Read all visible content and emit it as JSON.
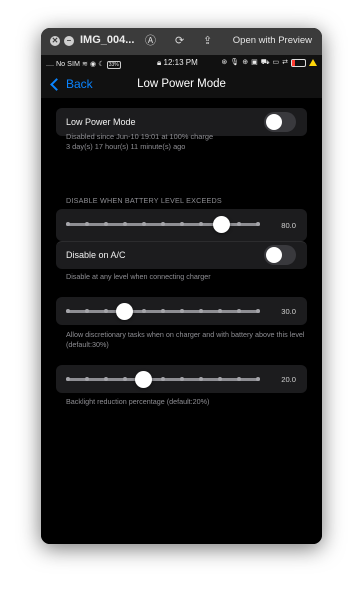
{
  "window": {
    "title": "IMG_004...",
    "open_label": "Open with Preview"
  },
  "statusbar": {
    "carrier": ".... No SIM",
    "time": "12:13 PM",
    "battery_badge": "33%",
    "colors": {
      "battery_low": "#ff3b30",
      "warning": "#ffd60a"
    }
  },
  "navbar": {
    "back_label": "Back",
    "title": "Low Power Mode",
    "accent": "#0a84ff"
  },
  "low_power": {
    "label": "Low Power Mode",
    "detail_line1": "Disabled since Jun-10 19:01 at 100% charge",
    "detail_line2": "3 day(s) 17 hour(s) 11 minute(s) ago",
    "enabled": false
  },
  "battery_section": {
    "header": "DISABLE WHEN BATTERY LEVEL EXCEEDS",
    "slider_value_label": "80.0",
    "slider_fraction": 0.8
  },
  "ac": {
    "label": "Disable on A/C",
    "enabled": false,
    "footer": "Disable at any level when connecting charger"
  },
  "discretionary": {
    "slider_value_label": "30.0",
    "slider_fraction": 0.3,
    "footer": "Allow discretionary tasks when on charger and with battery above this level (default:30%)"
  },
  "backlight": {
    "slider_value_label": "20.0",
    "slider_fraction": 0.4,
    "footer": "Backlight reduction percentage (default:20%)"
  }
}
